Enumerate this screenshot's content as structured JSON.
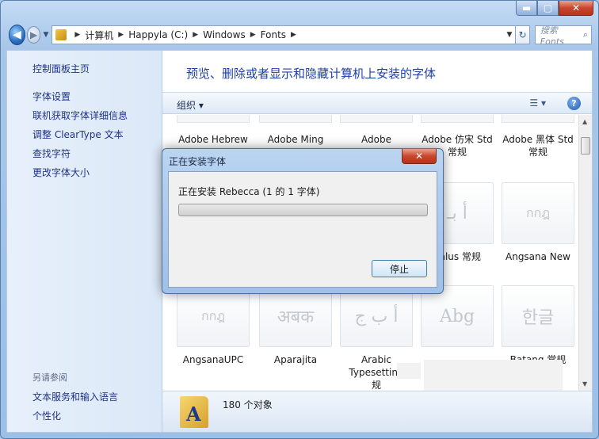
{
  "window": {
    "min_glyph": "▬",
    "max_glyph": "▢",
    "close_glyph": "✕"
  },
  "nav": {
    "back_glyph": "◀",
    "forward_glyph": "▶",
    "breadcrumb": [
      "计算机",
      "Happyla (C:)",
      "Windows",
      "Fonts"
    ],
    "search_placeholder": "搜索 Fonts"
  },
  "sidebar": {
    "home": "控制面板主页",
    "links": [
      "字体设置",
      "联机获取字体详细信息",
      "调整 ClearType 文本",
      "查找字符",
      "更改字体大小"
    ],
    "see_also_title": "另请参阅",
    "see_also": [
      "文本服务和输入语言",
      "个性化"
    ]
  },
  "main": {
    "title": "预览、删除或者显示和隐藏计算机上安装的字体",
    "organize": "组织 ▾",
    "view_glyph": "☰ ▾",
    "help_glyph": "?"
  },
  "fonts": {
    "row1": [
      {
        "line1": "Adobe Hebrew",
        "line2": ""
      },
      {
        "line1": "Adobe Ming",
        "line2": ""
      },
      {
        "line1": "Adobe",
        "line2": ""
      },
      {
        "line1": "Adobe 仿宋 Std",
        "line2": "常规"
      },
      {
        "line1": "Adobe 黑体 Std",
        "line2": "常规"
      }
    ],
    "row2": [
      {
        "line1": "dalus 常规",
        "preview": "أ بـ"
      },
      {
        "line1": "Angsana New",
        "preview": "กกฎ"
      }
    ],
    "row3": [
      {
        "line1": "AngsanaUPC",
        "line2": "",
        "line3": "",
        "preview": "กกฎ"
      },
      {
        "line1": "Aparajita",
        "line2": "",
        "line3": "",
        "preview": "अबक"
      },
      {
        "line1": "Arabic",
        "line2": "Typesetting",
        "line3": "规",
        "preview": "أ ب ج"
      },
      {
        "line1": "",
        "line2": "",
        "line3": "",
        "preview": "Abg"
      },
      {
        "line1": "Batang 常规",
        "line2": "",
        "line3": "",
        "preview": "한글"
      }
    ]
  },
  "status": {
    "count_text": "180 个对象",
    "folder_letter": "A"
  },
  "dialog": {
    "title": "正在安装字体",
    "message": "正在安装 Rebecca (1 的 1 字体)",
    "progress": 0.0,
    "stop_label": "停止",
    "close_glyph": "✕"
  }
}
